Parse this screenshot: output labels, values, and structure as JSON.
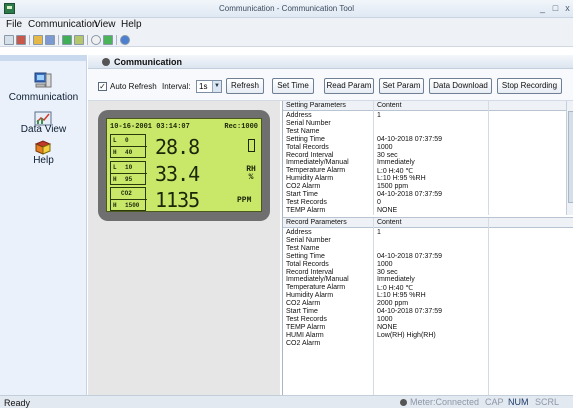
{
  "window": {
    "title": "Communication - Communication Tool",
    "minimize": "_",
    "maximize": "□",
    "close": "x"
  },
  "menu": [
    "File",
    "Communication",
    "View",
    "Help"
  ],
  "toolbar_icons": [
    "new-icon",
    "open-icon",
    "folder-icon",
    "save-icon",
    "export-icon",
    "copy-icon",
    "download-icon",
    "refresh-icon",
    "about-icon"
  ],
  "sidebar": {
    "items": [
      {
        "label": "Communication",
        "icon": "computer-icon"
      },
      {
        "label": "Data View",
        "icon": "chart-icon"
      },
      {
        "label": "Help",
        "icon": "book-icon"
      }
    ]
  },
  "panel": {
    "title": "Communication"
  },
  "controls": {
    "auto_refresh_label": "Auto Refresh",
    "auto_refresh_checked": "✓",
    "interval_label": "Interval:",
    "interval_value": "1s",
    "refresh": "Refresh",
    "set_time": "Set Time",
    "read_param": "Read Param",
    "set_param": "Set Param",
    "data_download": "Data Download",
    "stop_recording": "Stop Recording"
  },
  "lcd": {
    "datetime": "10-16-2001 03:14:07",
    "rec": "Rec:1000",
    "rows": [
      {
        "lo_k": "L",
        "lo_v": "0",
        "hi_k": "H",
        "hi_v": "40",
        "value": "28.8",
        "unit": ""
      },
      {
        "lo_k": "L",
        "lo_v": "10",
        "hi_k": "H",
        "hi_v": "95",
        "value": "33.4",
        "unit": "RH %"
      },
      {
        "lo_k": "",
        "lo_v": "CO2",
        "hi_k": "H",
        "hi_v": "1500",
        "value": "1135",
        "unit": "PPM"
      }
    ]
  },
  "setting_table": {
    "headers": [
      "Setting Parameters",
      "Content"
    ],
    "rows": [
      [
        "Address",
        "1"
      ],
      [
        "Serial Number",
        ""
      ],
      [
        "Test Name",
        ""
      ],
      [
        "Setting Time",
        "04-10-2018 07:37:59"
      ],
      [
        "Total Records",
        "1000"
      ],
      [
        "Record Interval",
        "30 sec"
      ],
      [
        "Immediately/Manual",
        "Immediately"
      ],
      [
        "Temperature Alarm",
        "L:0 H:40 ℃"
      ],
      [
        "Humidity Alarm",
        "L:10 H:95 %RH"
      ],
      [
        "CO2 Alarm",
        "1500 ppm"
      ],
      [
        "Start Time",
        "04-10-2018 07:37:59"
      ],
      [
        "Test Records",
        "0"
      ],
      [
        "TEMP Alarm",
        "NONE"
      ]
    ]
  },
  "record_table": {
    "headers": [
      "Record Parameters",
      "Content"
    ],
    "rows": [
      [
        "Address",
        "1"
      ],
      [
        "Serial Number",
        ""
      ],
      [
        "Test Name",
        ""
      ],
      [
        "Setting Time",
        "04-10-2018 07:37:59"
      ],
      [
        "Total Records",
        "1000"
      ],
      [
        "Record Interval",
        "30 sec"
      ],
      [
        "Immediately/Manual",
        "Immediately"
      ],
      [
        "Temperature Alarm",
        "L:0 H:40 ℃"
      ],
      [
        "Humidity Alarm",
        "L:10 H:95 %RH"
      ],
      [
        "CO2 Alarm",
        "2000 ppm"
      ],
      [
        "Start Time",
        "04-10-2018 07:37:59"
      ],
      [
        "Test Records",
        "1000"
      ],
      [
        "TEMP Alarm",
        "NONE"
      ],
      [
        "HUMI Alarm",
        "Low(RH) High(RH)"
      ],
      [
        "CO2 Alarm",
        ""
      ]
    ]
  },
  "status": {
    "ready": "Ready",
    "meter": "Meter:Connected",
    "cap": "CAP",
    "num": "NUM",
    "scrl": "SCRL"
  },
  "colors": {
    "lcd_bg": "#c9e86a",
    "device_bezel": "#6f6f6f",
    "accent": "#1d3a66"
  }
}
